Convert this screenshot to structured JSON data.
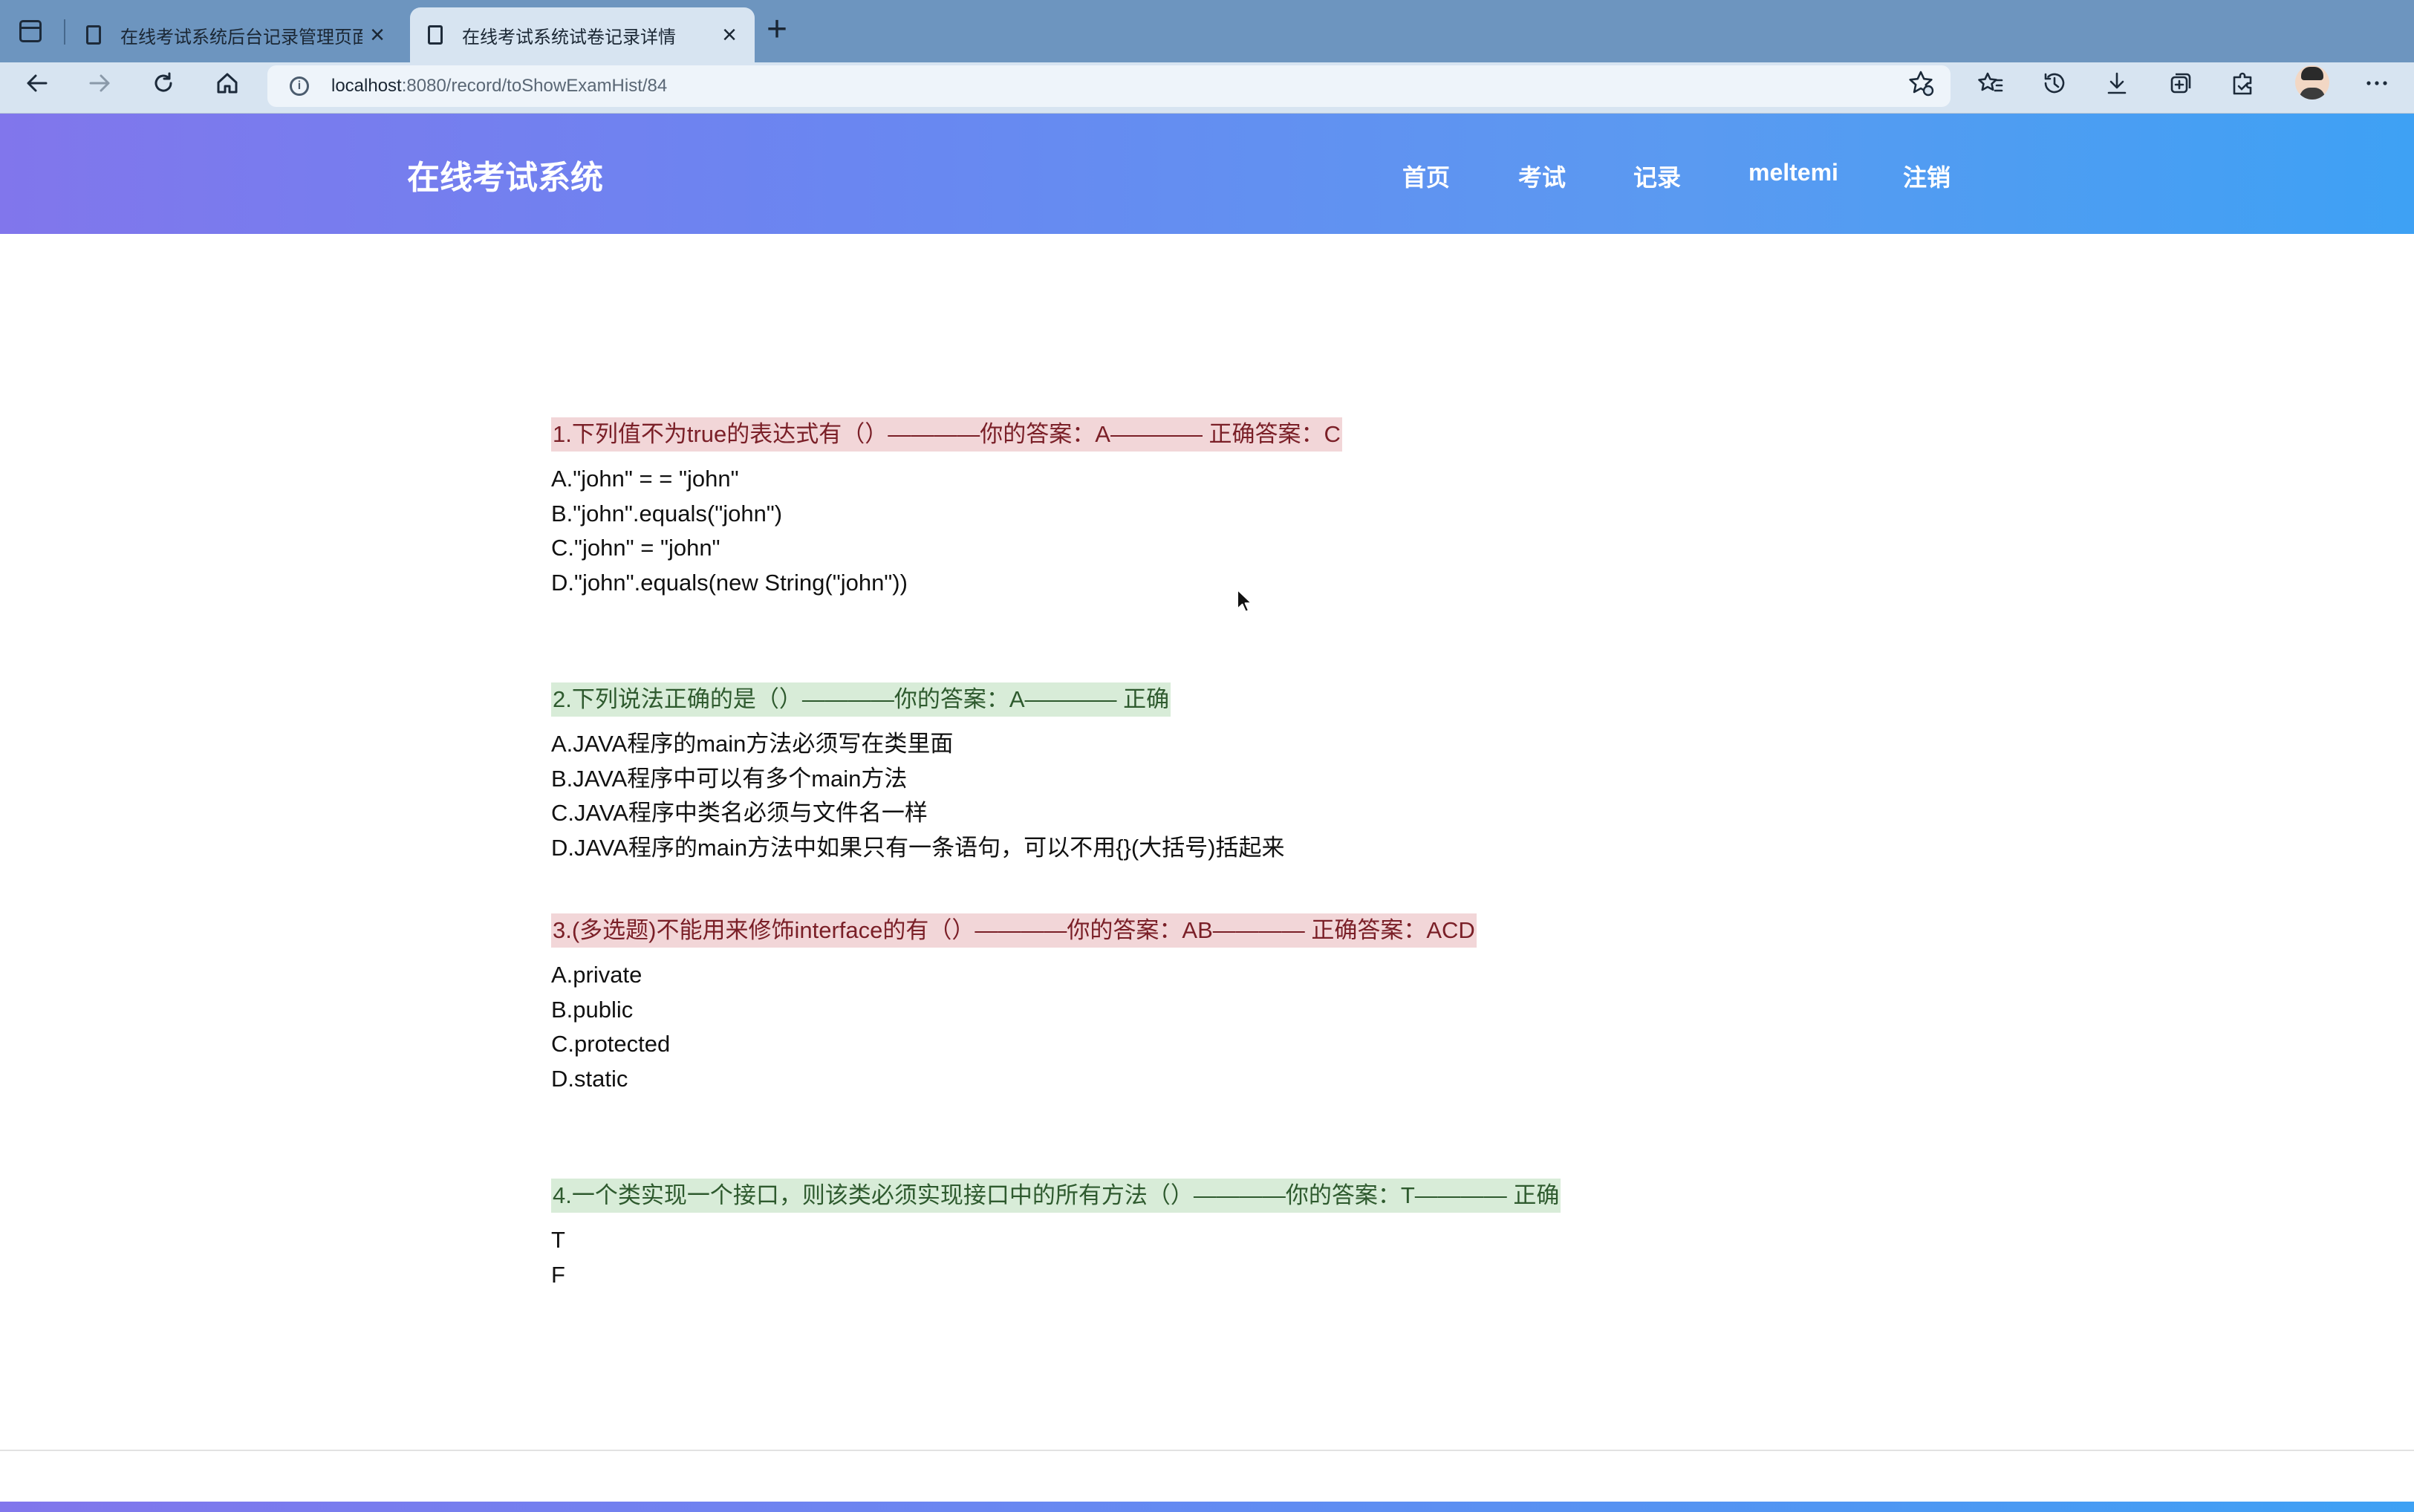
{
  "browser": {
    "tabs": [
      {
        "title": "在线考试系统后台记录管理页面",
        "active": false
      },
      {
        "title": "在线考试系统试卷记录详情",
        "active": true
      }
    ],
    "url": {
      "host": "localhost",
      "path": ":8080/record/toShowExamHist/84"
    }
  },
  "site": {
    "brand": "在线考试系统",
    "nav": {
      "home": "首页",
      "exam": "考试",
      "records": "记录",
      "user": "meltemi",
      "logout": "注销"
    }
  },
  "questions": [
    {
      "title": "1.下列值不为true的表达式有（）————你的答案：A———— 正确答案：C",
      "status": "wrong",
      "options": [
        "A.\"john\" = = \"john\"",
        "B.\"john\".equals(\"john\")",
        "C.\"john\" = \"john\"",
        "D.\"john\".equals(new String(\"john\"))"
      ]
    },
    {
      "title": "2.下列说法正确的是（）————你的答案：A———— 正确",
      "status": "right",
      "options": [
        "A.JAVA程序的main方法必须写在类里面",
        "B.JAVA程序中可以有多个main方法",
        "C.JAVA程序中类名必须与文件名一样",
        "D.JAVA程序的main方法中如果只有一条语句，可以不用{}(大括号)括起来"
      ]
    },
    {
      "title": "3.(多选题)不能用来修饰interface的有（）————你的答案：AB———— 正确答案：ACD",
      "status": "wrong",
      "options": [
        "A.private",
        "B.public",
        "C.protected",
        "D.static"
      ]
    },
    {
      "title": "4.一个类实现一个接口，则该类必须实现接口中的所有方法（）————你的答案：T———— 正确",
      "status": "right",
      "options": [
        "T",
        "F"
      ]
    }
  ],
  "icons": {
    "back": "arrow-left-icon",
    "forward": "arrow-right-icon",
    "reload": "reload-icon",
    "home": "home-icon",
    "favorite": "star-icon",
    "favorites": "favorites-icon",
    "history": "history-icon",
    "downloads": "download-icon",
    "collections": "collections-icon",
    "extensions": "extensions-icon",
    "more": "more-icon"
  },
  "colors": {
    "wrong_bg": "#f2d6d8",
    "right_bg": "#d8ecd8",
    "header_start": "#8176ec",
    "header_end": "#3ea1f4"
  }
}
